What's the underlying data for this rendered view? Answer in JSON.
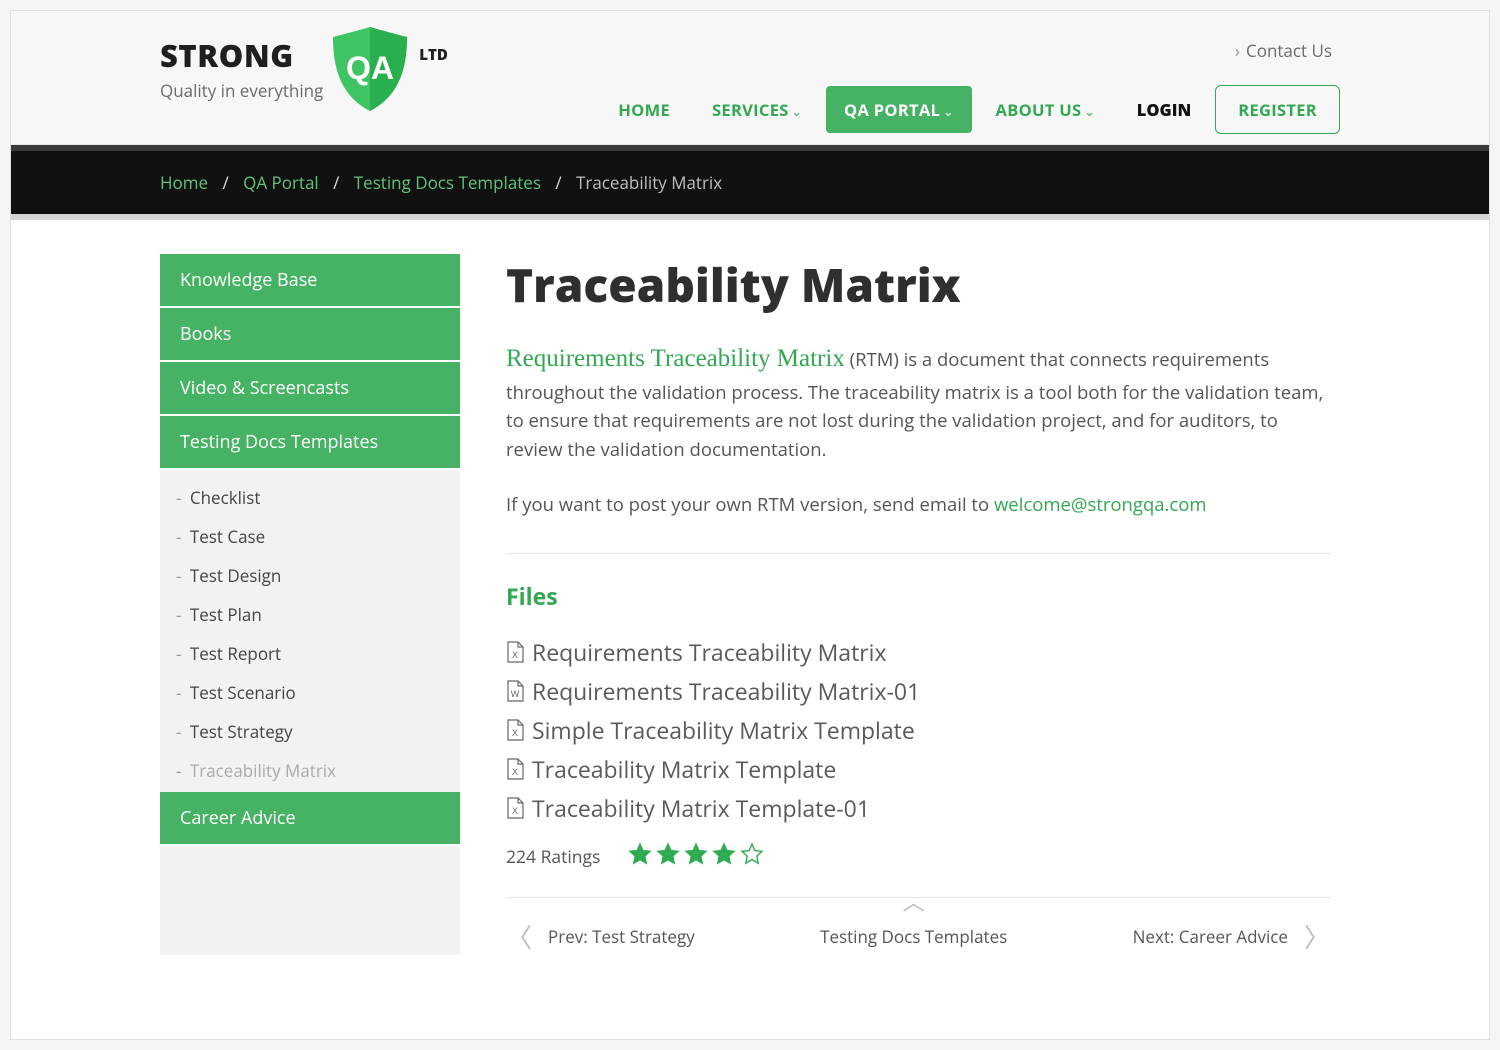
{
  "header": {
    "logo_strong": "STRONG",
    "logo_qa": "QA",
    "logo_ltd": "LTD",
    "tagline": "Quality in everything",
    "contact": "Contact Us"
  },
  "nav": {
    "home": "Home",
    "services": "Services",
    "qa_portal": "QA Portal",
    "about_us": "About Us",
    "login": "Login",
    "register": "Register"
  },
  "breadcrumb": {
    "home": "Home",
    "qa_portal": "QA Portal",
    "tdt": "Testing Docs Templates",
    "current": "Traceability Matrix"
  },
  "sidebar": {
    "cats": [
      "Knowledge Base",
      "Books",
      "Video & Screencasts",
      "Testing Docs Templates",
      "Career Advice"
    ],
    "subs": [
      "Checklist",
      "Test Case",
      "Test Design",
      "Test Plan",
      "Test Report",
      "Test Scenario",
      "Test Strategy",
      "Traceability Matrix"
    ]
  },
  "main": {
    "title": "Traceability Matrix",
    "lead_green": "Requirements Traceability Matrix",
    "lead_rest": " (RTM) is a document that connects requirements throughout the validation process. The traceability matrix is a tool both for the validation team, to ensure that requirements are not lost during the validation project, and for auditors, to review the validation documentation.",
    "post_prompt": "If you want to post your own RTM version, send email to ",
    "email": "welcome@strongqa.com",
    "files_heading": "Files",
    "files": [
      {
        "type": "x",
        "name": "Requirements Traceability Matrix"
      },
      {
        "type": "w",
        "name": "Requirements Traceability Matrix-01"
      },
      {
        "type": "x",
        "name": "Simple Traceability Matrix Template"
      },
      {
        "type": "x",
        "name": "Traceability Matrix Template"
      },
      {
        "type": "x",
        "name": "Traceability Matrix Template-01"
      }
    ],
    "ratings_text": "224 Ratings",
    "stars_filled": 4,
    "stars_total": 5
  },
  "pager": {
    "prev": "Prev: Test Strategy",
    "up": "Testing Docs Templates",
    "next": "Next: Career Advice"
  },
  "colors": {
    "green": "#32a852",
    "green_bg": "#45b363"
  }
}
